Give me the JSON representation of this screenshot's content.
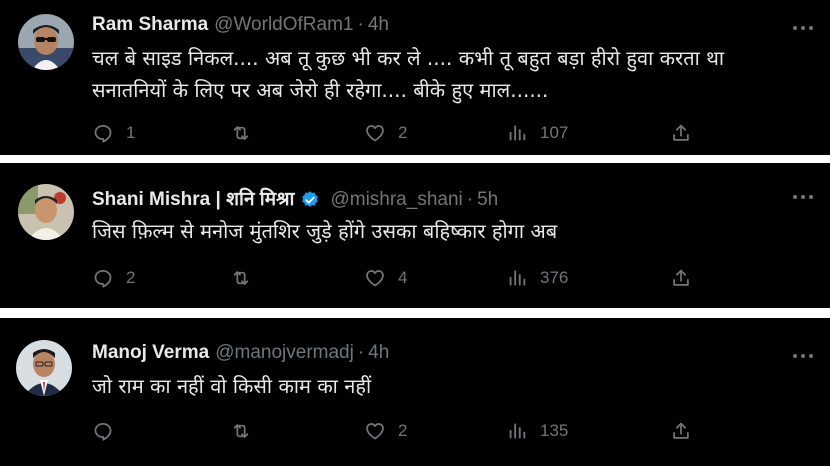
{
  "tweets": [
    {
      "name": "Ram Sharma",
      "handle": "@WorldOfRam1",
      "separator": "·",
      "time": "4h",
      "verified": false,
      "text_lines": [
        "चल बे साइड निकल.... अब तू कुछ भी कर ले .... कभी तू बहुत बड़ा हीरो हुवा करता था",
        "सनातनियों के लिए पर अब जेरो ही रहेगा.... बीके हुए माल......"
      ],
      "replies": "1",
      "retweets": "",
      "likes": "2",
      "views": "107"
    },
    {
      "name": "Shani Mishra | शनि मिश्रा",
      "handle": "@mishra_shani",
      "separator": "·",
      "time": "5h",
      "verified": true,
      "text_lines": [
        "जिस फ़िल्म से मनोज मुंतशिर जुड़े होंगे उसका बहिष्कार होगा अब"
      ],
      "replies": "2",
      "retweets": "",
      "likes": "4",
      "views": "376"
    },
    {
      "name": "Manoj Verma",
      "handle": "@manojvermadj",
      "separator": "·",
      "time": "4h",
      "verified": false,
      "text_lines": [
        "जो राम का नहीं वो किसी काम का नहीं"
      ],
      "replies": "",
      "retweets": "",
      "likes": "2",
      "views": "135"
    }
  ],
  "colors": {
    "background": "#000000",
    "text": "#e7e9ea",
    "muted": "#71767b",
    "verified": "#1d9bf0",
    "divider": "#ffffff"
  },
  "icons": [
    "reply-icon",
    "retweet-icon",
    "like-icon",
    "views-icon",
    "share-icon",
    "more-icon",
    "verified-badge-icon"
  ]
}
